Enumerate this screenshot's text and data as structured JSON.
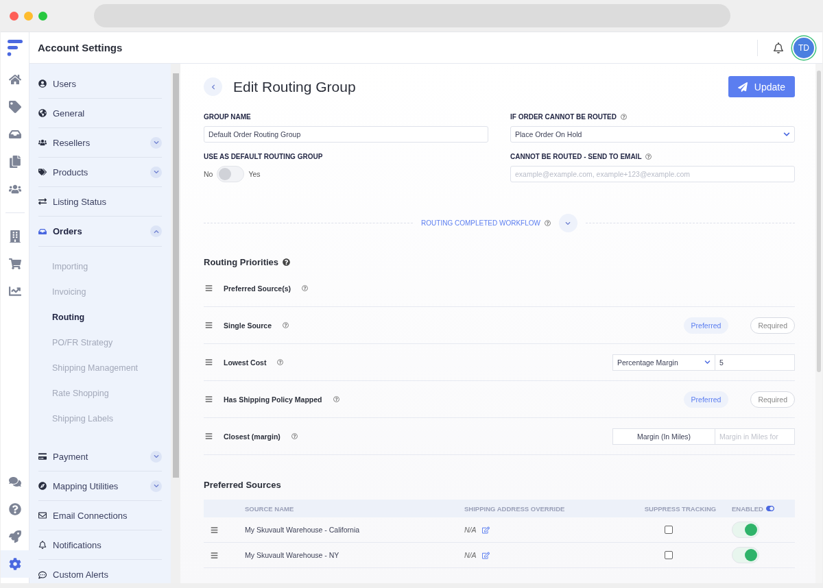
{
  "header": {
    "title": "Account Settings",
    "avatar": "TD"
  },
  "rail": [
    {
      "selected": false
    },
    {
      "selected": false
    },
    {
      "selected": false
    },
    {
      "selected": false
    },
    {
      "selected": false
    },
    {
      "selected": false
    },
    {
      "selected": false
    },
    {
      "selected": false
    },
    {
      "selected": false
    },
    {
      "selected": false
    },
    {
      "selected": false
    },
    {
      "selected": true
    }
  ],
  "sidebar": [
    {
      "label": "Users",
      "kind": "link",
      "selected": false
    },
    {
      "label": "General",
      "kind": "link",
      "selected": false
    },
    {
      "label": "Resellers",
      "kind": "group",
      "expanded": false,
      "selected": false
    },
    {
      "label": "Products",
      "kind": "group",
      "expanded": false,
      "selected": false
    },
    {
      "label": "Listing Status",
      "kind": "link",
      "selected": false
    },
    {
      "label": "Orders",
      "kind": "group",
      "expanded": true,
      "selected": true,
      "children": [
        {
          "label": "Importing",
          "selected": false
        },
        {
          "label": "Invoicing",
          "selected": false
        },
        {
          "label": "Routing",
          "selected": true
        },
        {
          "label": "PO/FR Strategy",
          "selected": false
        },
        {
          "label": "Shipping Management",
          "selected": false
        },
        {
          "label": "Rate Shopping",
          "selected": false
        },
        {
          "label": "Shipping Labels",
          "selected": false
        }
      ]
    },
    {
      "label": "Payment",
      "kind": "group",
      "expanded": false,
      "selected": false
    },
    {
      "label": "Mapping Utilities",
      "kind": "group",
      "expanded": false,
      "selected": false
    },
    {
      "label": "Email Connections",
      "kind": "link",
      "selected": false
    },
    {
      "label": "Notifications",
      "kind": "link",
      "selected": false
    },
    {
      "label": "Custom Alerts",
      "kind": "link",
      "selected": false
    }
  ],
  "page": {
    "title": "Edit Routing Group",
    "update_button": "Update"
  },
  "form": {
    "group_name": {
      "label": "GROUP NAME",
      "value": "Default Order Routing Group"
    },
    "if_unroutable": {
      "label": "IF ORDER CANNOT BE ROUTED",
      "value": "Place Order On Hold"
    },
    "default_group": {
      "label": "USE AS DEFAULT ROUTING GROUP",
      "off_label": "No",
      "on_label": "Yes",
      "on": false
    },
    "send_to_email": {
      "label": "CANNOT BE ROUTED - SEND TO EMAIL",
      "placeholder": "example@example.com, example+123@example.com"
    }
  },
  "workflow": {
    "label": "ROUTING COMPLETED WORKFLOW",
    "expanded": false
  },
  "priorities": {
    "title": "Routing Priorities",
    "rows": [
      {
        "kind": "plain",
        "label": "Preferred Source(s)"
      },
      {
        "kind": "choice",
        "label": "Single Source",
        "options": [
          {
            "label": "Preferred",
            "selected": true
          },
          {
            "label": "Required",
            "selected": false
          }
        ]
      },
      {
        "kind": "select",
        "label": "Lowest Cost",
        "value": "Percentage Margin",
        "amount": "5"
      },
      {
        "kind": "choice",
        "label": "Has Shipping Policy Mapped",
        "options": [
          {
            "label": "Preferred",
            "selected": true
          },
          {
            "label": "Required",
            "selected": false
          }
        ]
      },
      {
        "kind": "miles",
        "label": "Closest (margin)",
        "unit": "Margin (In Miles)",
        "placeholder": "Margin in Miles for"
      }
    ]
  },
  "sources": {
    "title": "Preferred Sources",
    "columns": [
      "SOURCE NAME",
      "SHIPPING ADDRESS OVERRIDE",
      "SUPPRESS TRACKING",
      "ENABLED"
    ],
    "rows": [
      {
        "name": "My Skuvault Warehouse - California",
        "override": "N/A",
        "suppress": false,
        "enabled": true
      },
      {
        "name": "My Skuvault Warehouse - NY",
        "override": "N/A",
        "suppress": false,
        "enabled": true
      }
    ]
  }
}
